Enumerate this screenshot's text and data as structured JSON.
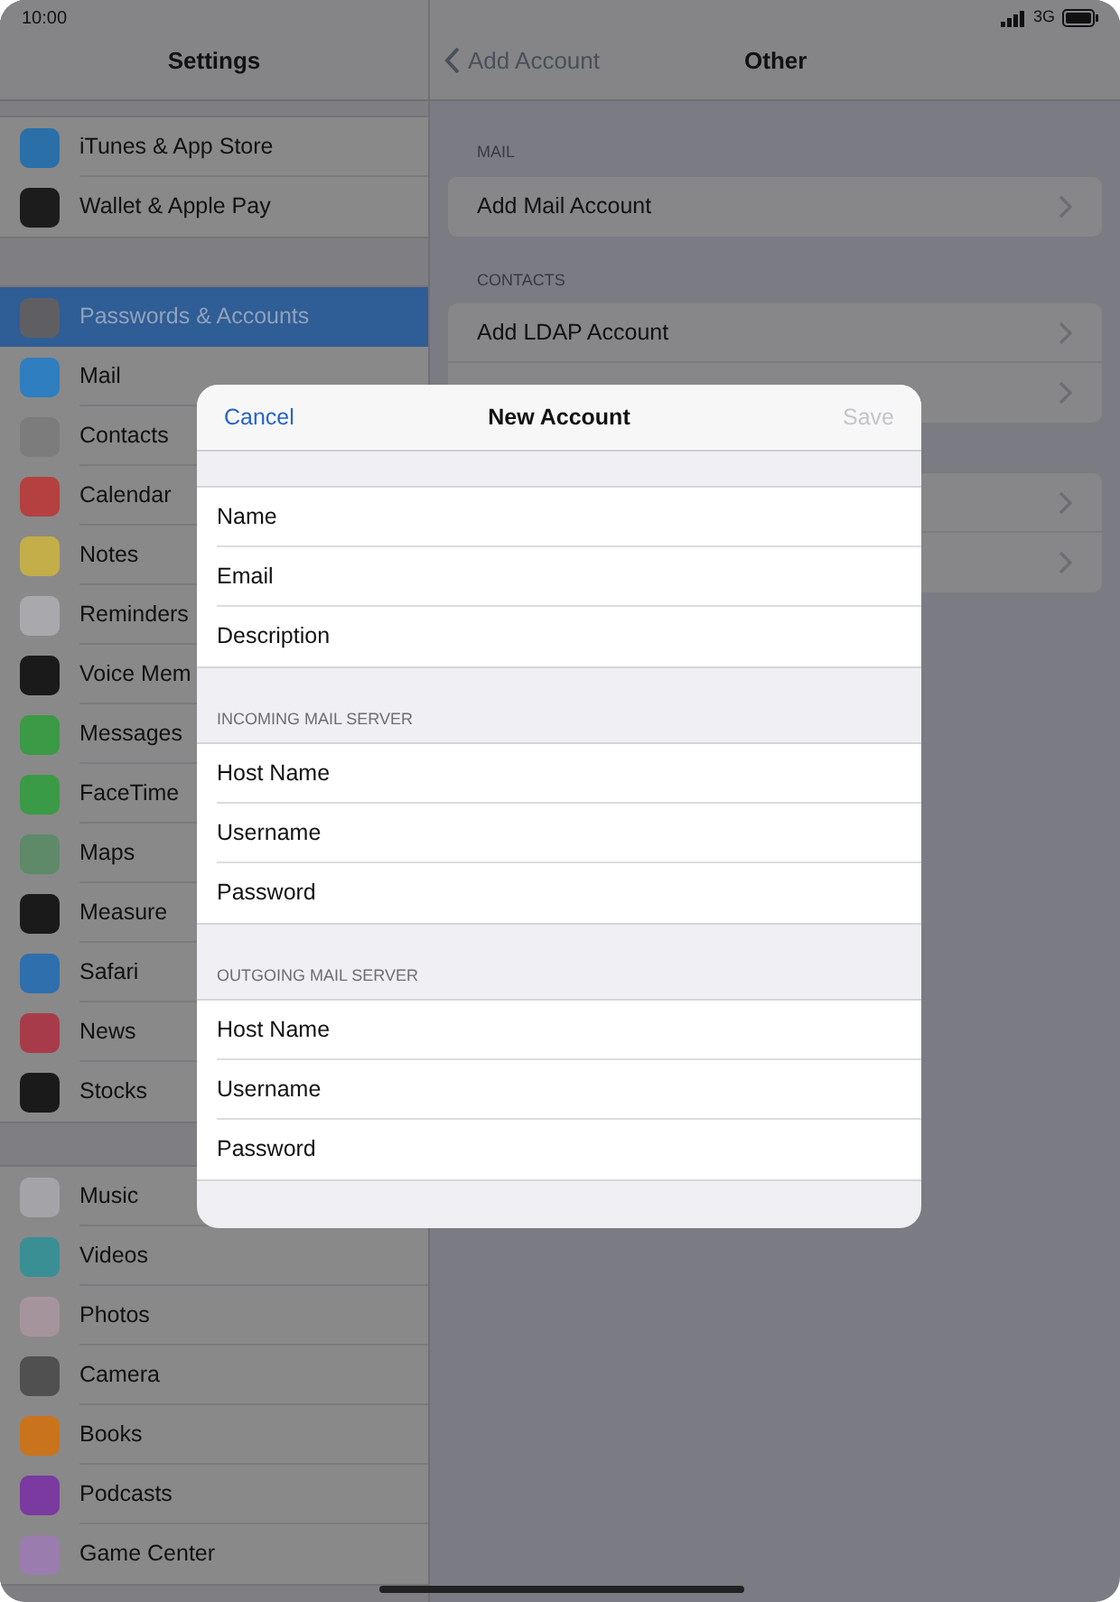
{
  "status_bar": {
    "time": "10:00",
    "network": "3G"
  },
  "sidebar": {
    "title": "Settings",
    "groups": [
      [
        {
          "label": "iTunes & App Store",
          "color": "#2a6fa8",
          "selected": false
        },
        {
          "label": "Wallet & Apple Pay",
          "color": "#1c1c1c",
          "selected": false
        }
      ],
      [
        {
          "label": "Passwords & Accounts",
          "color": "#5f5f63",
          "selected": true
        },
        {
          "label": "Mail",
          "color": "#2e7ec0",
          "selected": false
        },
        {
          "label": "Contacts",
          "color": "#7c7c7c",
          "selected": false
        },
        {
          "label": "Calendar",
          "color": "#b54040",
          "selected": false
        },
        {
          "label": "Notes",
          "color": "#c4ae4a",
          "selected": false
        },
        {
          "label": "Reminders",
          "color": "#a9a9ad",
          "selected": false
        },
        {
          "label": "Voice Mem",
          "color": "#1a1a1a",
          "selected": false
        },
        {
          "label": "Messages",
          "color": "#3b9a45",
          "selected": false
        },
        {
          "label": "FaceTime",
          "color": "#3b9a45",
          "selected": false
        },
        {
          "label": "Maps",
          "color": "#5e8a6a",
          "selected": false
        },
        {
          "label": "Measure",
          "color": "#1a1a1a",
          "selected": false
        },
        {
          "label": "Safari",
          "color": "#2f6fae",
          "selected": false
        },
        {
          "label": "News",
          "color": "#a83b4a",
          "selected": false
        },
        {
          "label": "Stocks",
          "color": "#1a1a1a",
          "selected": false
        }
      ],
      [
        {
          "label": "Music",
          "color": "#a4a4a8",
          "selected": false
        },
        {
          "label": "Videos",
          "color": "#3a8f95",
          "selected": false
        },
        {
          "label": "Photos",
          "color": "#a6949c",
          "selected": false
        },
        {
          "label": "Camera",
          "color": "#505050",
          "selected": false
        },
        {
          "label": "Books",
          "color": "#c9741d",
          "selected": false
        },
        {
          "label": "Podcasts",
          "color": "#7a3aa0",
          "selected": false
        },
        {
          "label": "Game Center",
          "color": "#9a7cae",
          "selected": false
        }
      ]
    ]
  },
  "detail": {
    "back": "Add Account",
    "title": "Other",
    "sections": [
      {
        "header": "MAIL",
        "rows": [
          {
            "label": "Add Mail Account"
          }
        ]
      },
      {
        "header": "CONTACTS",
        "rows": [
          {
            "label": "Add LDAP Account"
          },
          {}
        ]
      },
      {
        "rows": [
          {},
          {}
        ]
      }
    ]
  },
  "modal": {
    "cancel": "Cancel",
    "title": "New Account",
    "save": "Save",
    "save_disabled": true,
    "sections": [
      {
        "fields": [
          "Name",
          "Email",
          "Description"
        ]
      },
      {
        "header": "INCOMING MAIL SERVER",
        "fields": [
          "Host Name",
          "Username",
          "Password"
        ]
      },
      {
        "header": "OUTGOING MAIL SERVER",
        "fields": [
          "Host Name",
          "Username",
          "Password"
        ]
      }
    ]
  }
}
